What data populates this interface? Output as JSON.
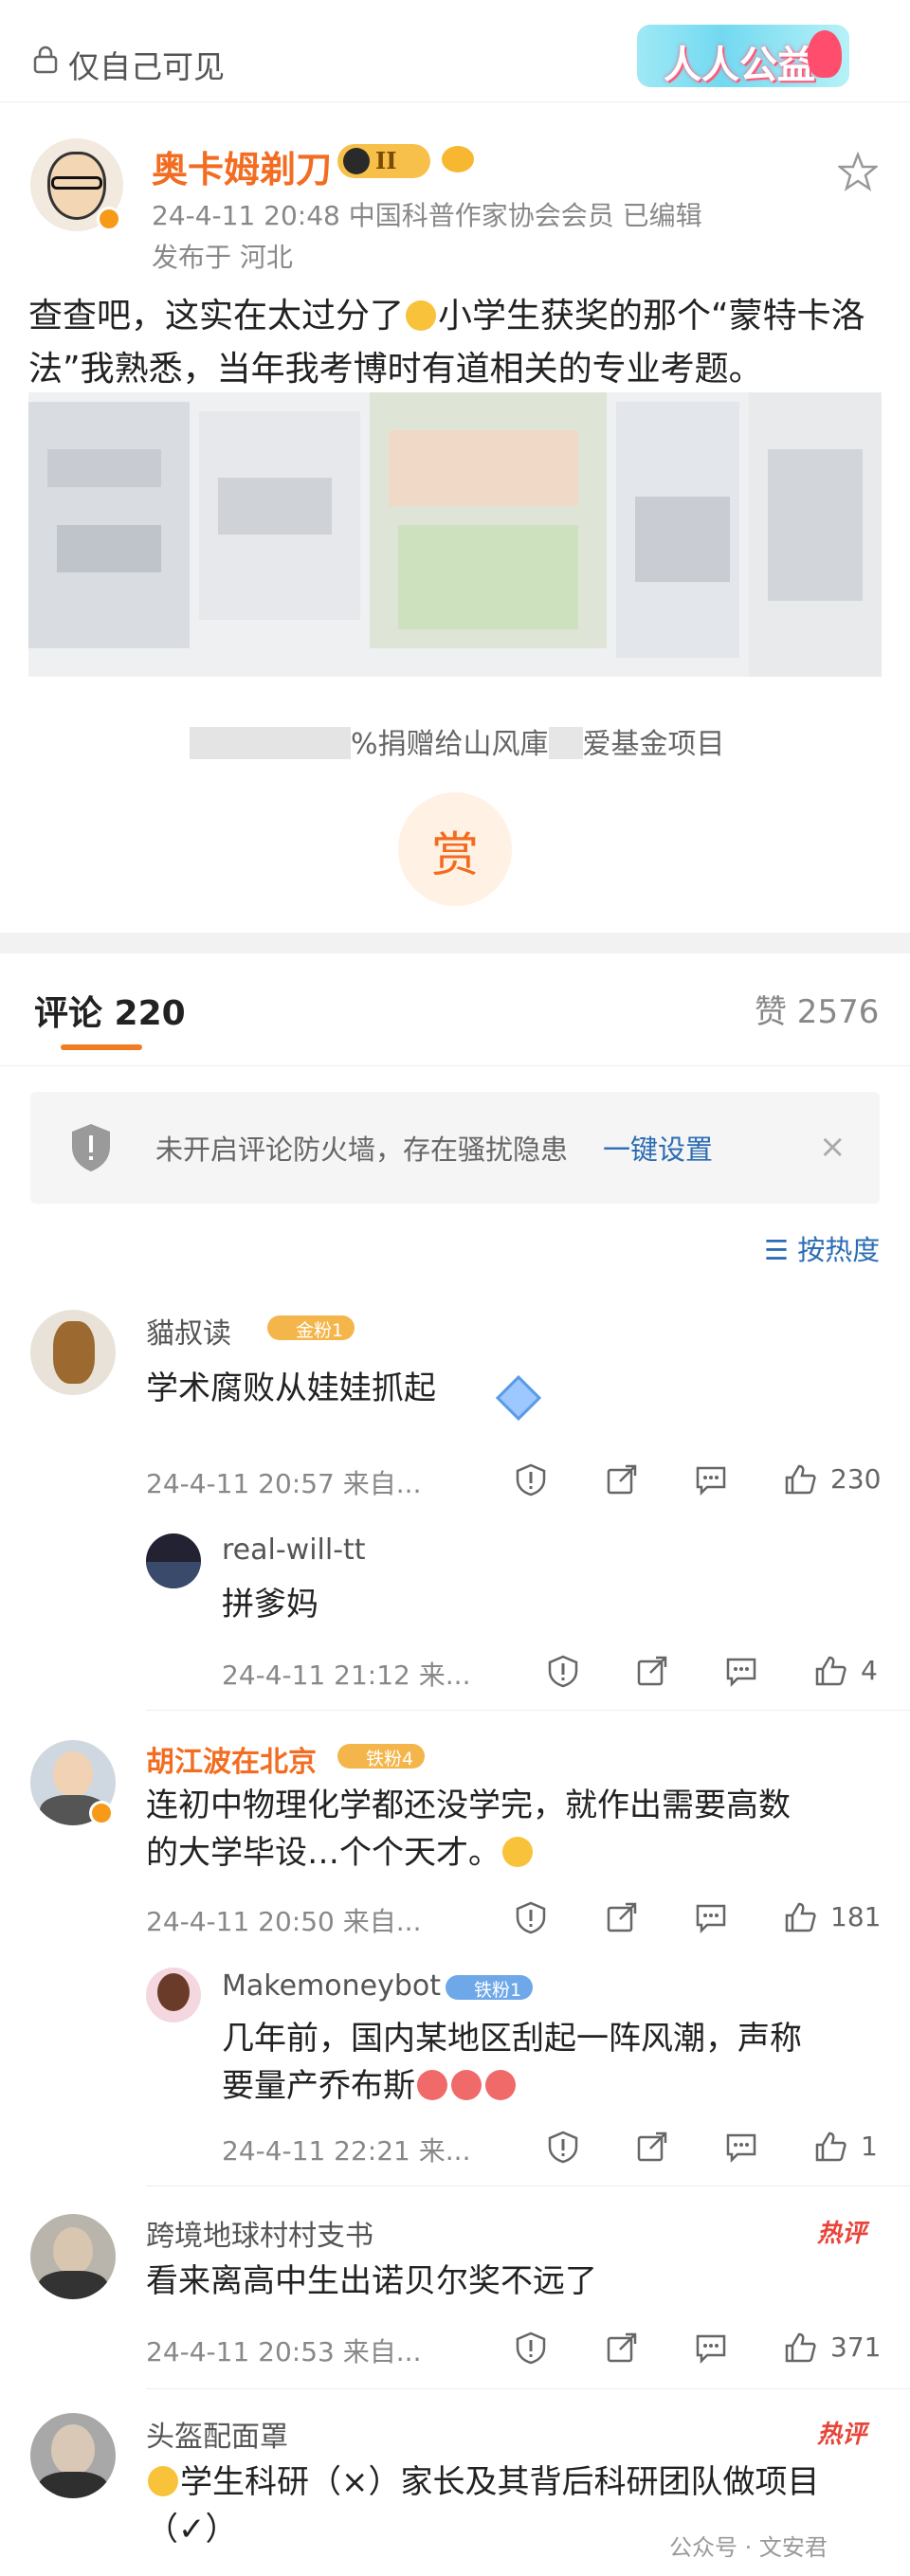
{
  "topbar": {
    "visibility": "仅自己可见",
    "gongyi_logo": "人人公益"
  },
  "post": {
    "username": "奥卡姆剃刀",
    "member_level": "II",
    "timestamp_line": "24-4-11 20:48  中国科普作家协会会员  已编辑",
    "location_line": "发布于 河北",
    "text_part1": "查查吧，这实在太过分了",
    "text_part2": "小学生获奖的那个“蒙特卡洛法”我熟悉，当年我考博时有道相关的专业考题。",
    "image_caption_visible": "%捐赠给山风庫",
    "image_caption_end": "爱基金项目",
    "reward_label": "赏"
  },
  "tabs": {
    "comments_label": "评论 220",
    "likes_label": "赞 2576"
  },
  "firewall": {
    "text": "未开启评论防火墙，存在骚扰隐患",
    "action": "一键设置",
    "close": "×"
  },
  "sort": {
    "label": "按热度"
  },
  "comments": [
    {
      "name": "貓叔读",
      "badge": "金粉1",
      "text": "学术腐败从娃娃抓起",
      "time": "24-4-11 20:57 来自...",
      "likes": "230",
      "reply": {
        "name": "real-will-tt",
        "text": "拼爹妈",
        "time": "24-4-11 21:12 来...",
        "likes": "4"
      }
    },
    {
      "name": "胡江波在北京",
      "badge": "铁粉4",
      "text1": "连初中物理化学都还没学完，就作出需要高数",
      "text2": "的大学毕设…个个天才。",
      "time": "24-4-11 20:50 来自...",
      "likes": "181",
      "reply": {
        "name": "Makemoneybot",
        "badge": "铁粉1",
        "text1": "几年前，国内某地区刮起一阵风潮，声称",
        "text2": "要量产乔布斯",
        "time": "24-4-11 22:21 来...",
        "likes": "1"
      }
    },
    {
      "name": "跨境地球村村支书",
      "hot": "热评",
      "text": "看来离高中生出诺贝尔奖不远了",
      "time": "24-4-11 20:53 来自...",
      "likes": "371"
    },
    {
      "name": "头盔配面罩",
      "hot": "热评",
      "text1": "学生科研（×）家长及其背后科研团队做项目",
      "text2": "（✓）"
    }
  ],
  "watermark": "公众号 · 文安君",
  "colors": {
    "accent": "#f26d22",
    "link": "#2b6cb3",
    "hot": "#e8443a"
  }
}
